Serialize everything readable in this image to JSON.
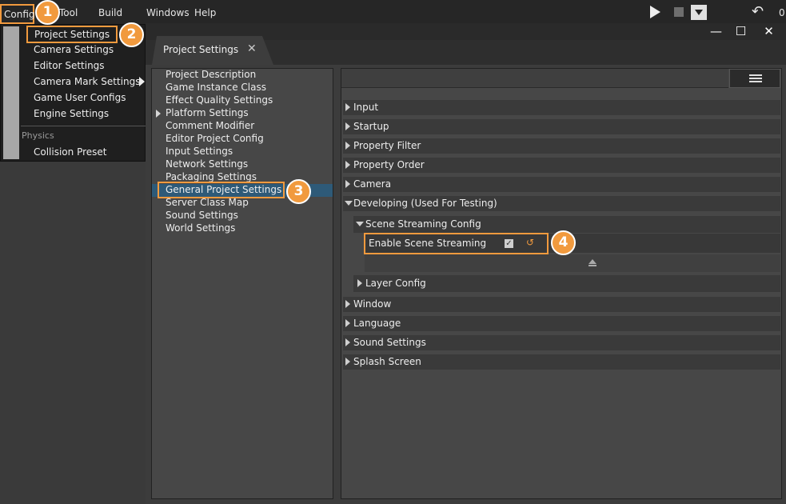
{
  "menubar": {
    "items": [
      "Config",
      "Tool",
      "Build",
      "Windows",
      "Help"
    ],
    "undo_count": "0"
  },
  "config_menu": {
    "items": [
      "Project Settings",
      "Camera Settings",
      "Editor Settings",
      "Camera Mark Settings",
      "Game User Configs",
      "Engine Settings"
    ],
    "section": "Physics",
    "section_items": [
      "Collision Preset"
    ]
  },
  "window": {
    "tab_title": "Project Settings"
  },
  "nav": {
    "items": [
      "Project Description",
      "Game Instance Class",
      "Effect Quality Settings",
      "Platform Settings",
      "Comment Modifier",
      "Editor Project Config",
      "Input Settings",
      "Network Settings",
      "Packaging Settings",
      "General Project Settings",
      "Server Class Map",
      "Sound Settings",
      "World Settings"
    ],
    "selected": "General Project Settings"
  },
  "details": {
    "categories_top": [
      "Input",
      "Startup",
      "Property Filter",
      "Property Order",
      "Camera"
    ],
    "developing": "Developing (Used For Testing)",
    "scene_streaming_config": "Scene Streaming Config",
    "enable_scene_streaming": "Enable Scene Streaming",
    "enable_scene_streaming_checked": true,
    "layer_config": "Layer Config",
    "categories_bottom": [
      "Window",
      "Language",
      "Sound Settings",
      "Splash Screen"
    ]
  },
  "badges": [
    "1",
    "2",
    "3",
    "4"
  ],
  "colors": {
    "accent": "#f19a3e",
    "selection": "#2e5a78"
  }
}
